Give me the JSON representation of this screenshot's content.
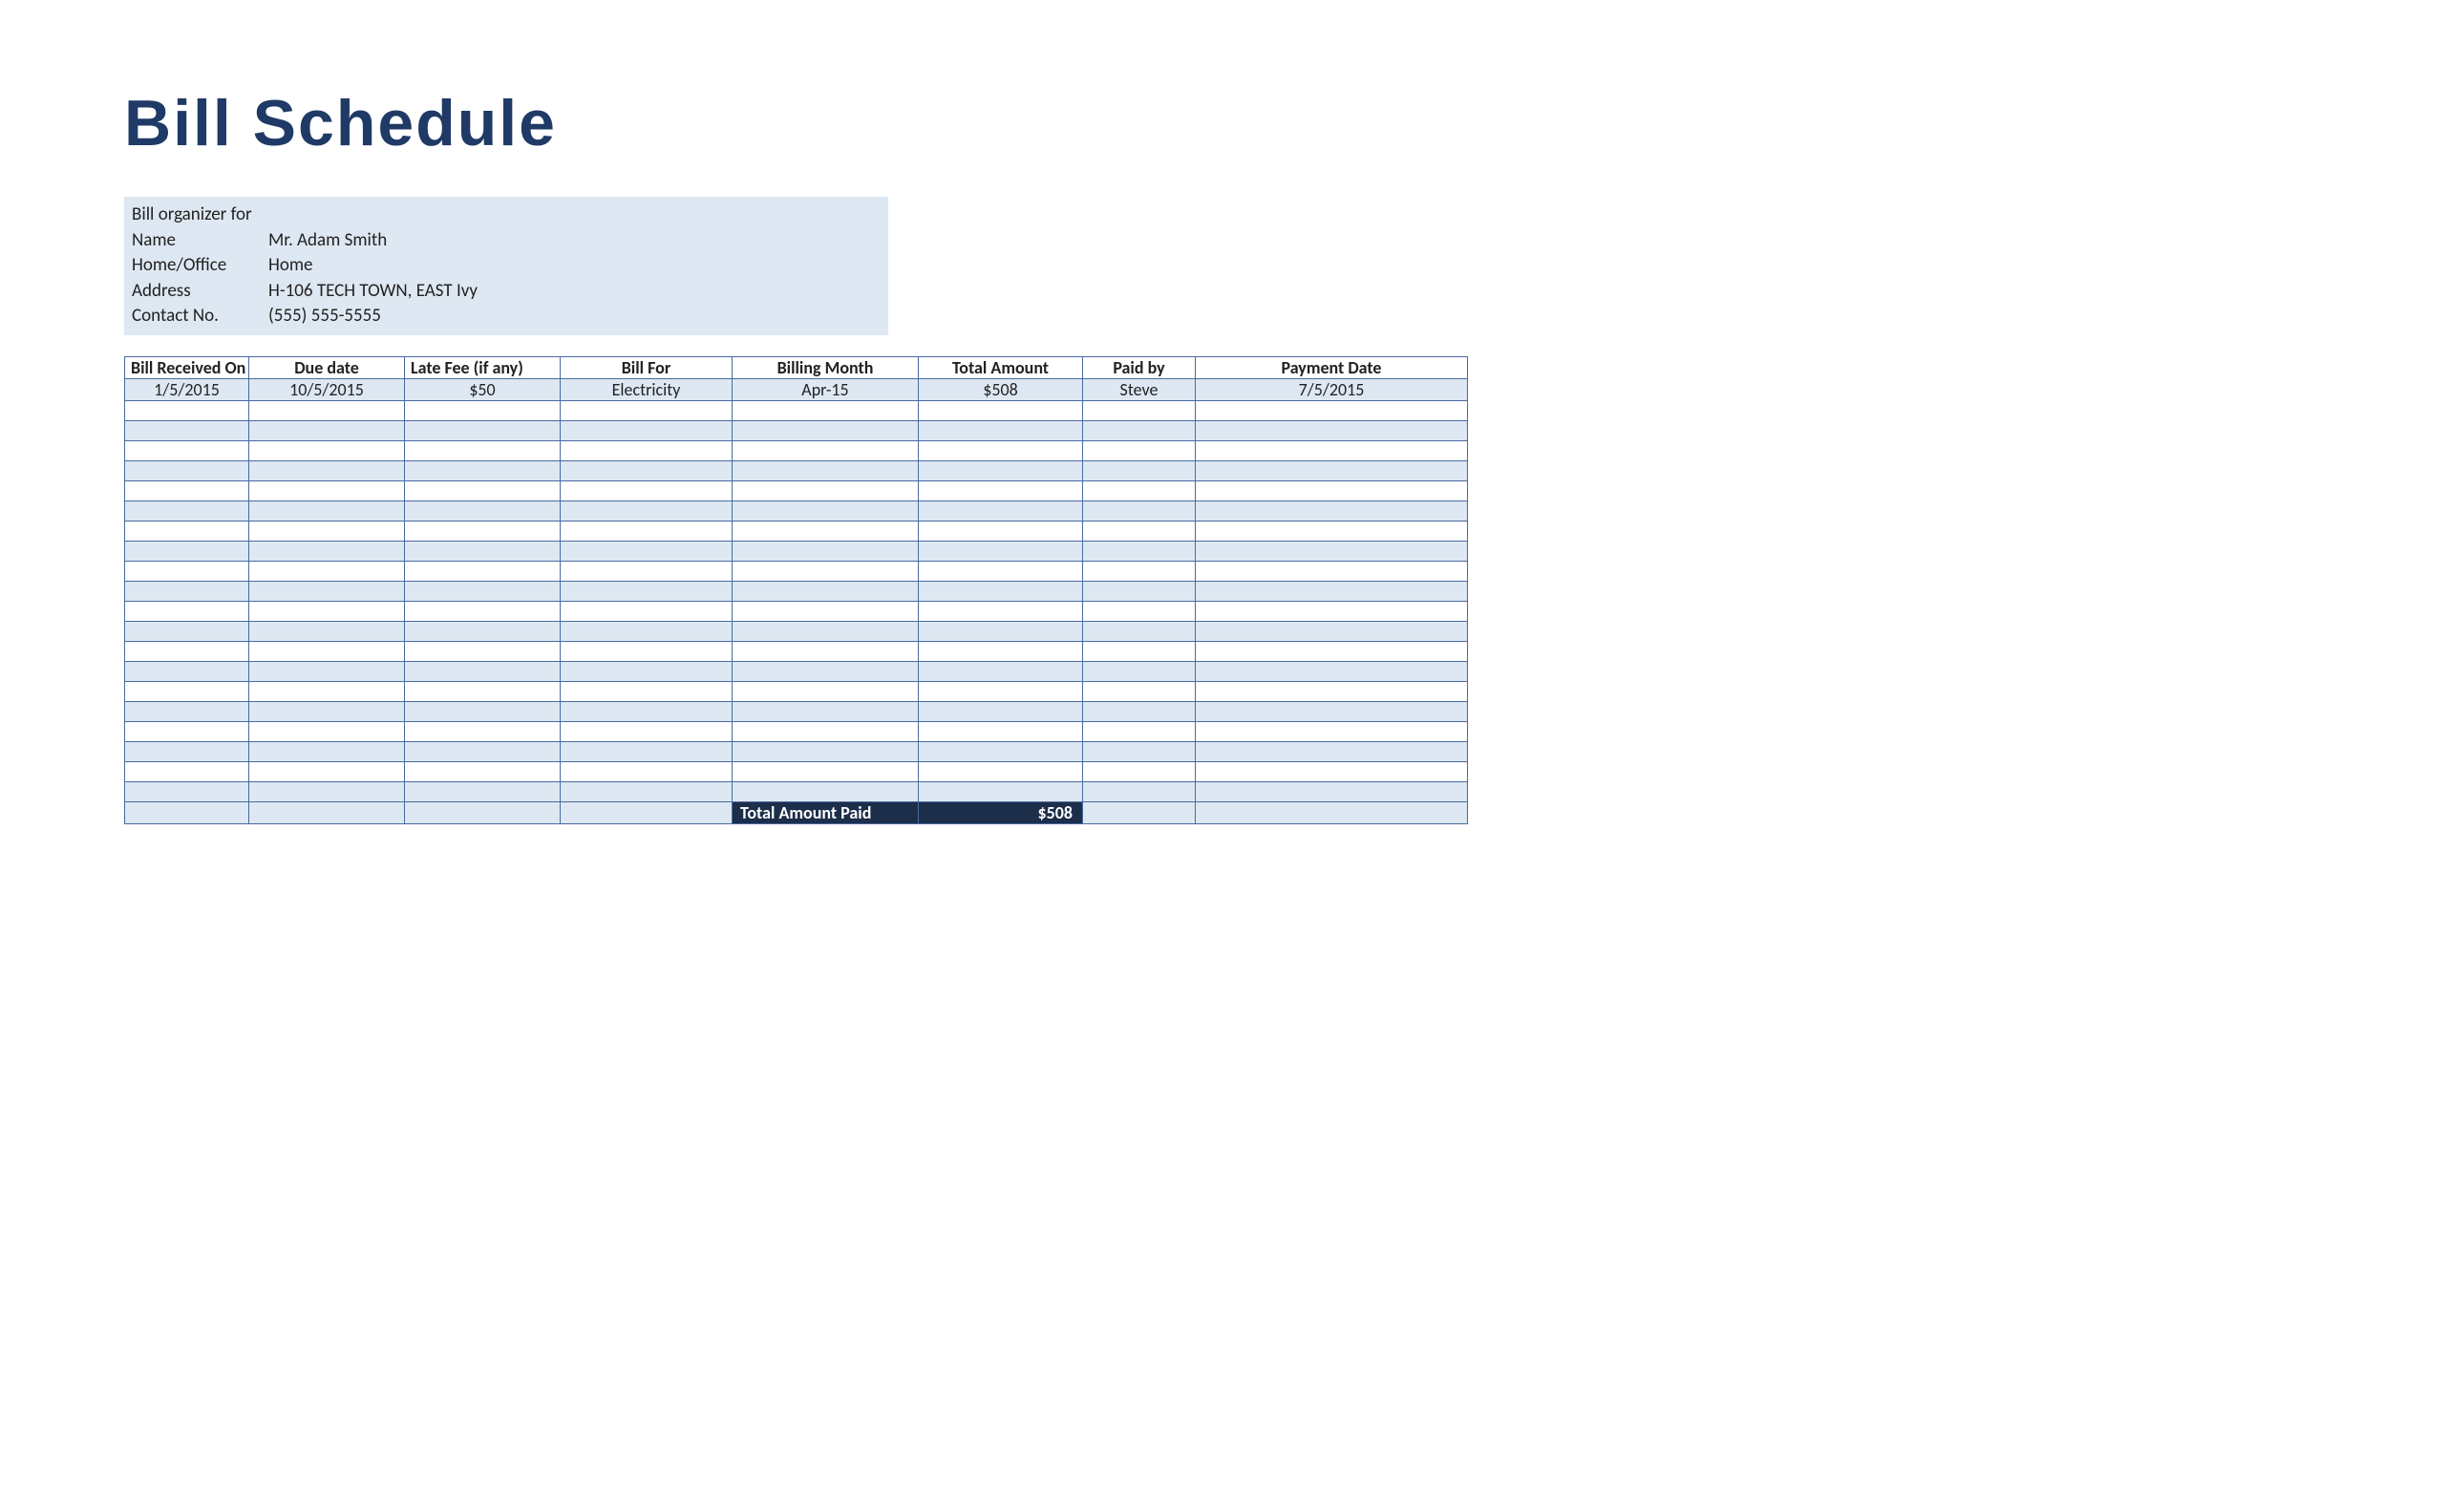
{
  "title": "Bill Schedule",
  "info": {
    "organizer_label": "Bill organizer for",
    "name_label": "Name",
    "name_value": "Mr. Adam Smith",
    "home_office_label": "Home/Office",
    "home_office_value": "Home",
    "address_label": "Address",
    "address_value": "H-106 TECH TOWN, EAST Ivy",
    "contact_label": "Contact No.",
    "contact_value": "(555) 555-5555"
  },
  "headers": {
    "received": "Bill Received On",
    "due": "Due date",
    "late": "Late Fee (if any)",
    "for": "Bill For",
    "month": "Billing Month",
    "amount": "Total Amount",
    "paidby": "Paid by",
    "paydate": "Payment Date"
  },
  "row1": {
    "received": "1/5/2015",
    "due": "10/5/2015",
    "late": "$50",
    "for": "Electricity",
    "month": "Apr-15",
    "amount": "$508",
    "paidby": "Steve",
    "paydate": "7/5/2015"
  },
  "total": {
    "label": "Total Amount Paid",
    "value": "$508"
  }
}
